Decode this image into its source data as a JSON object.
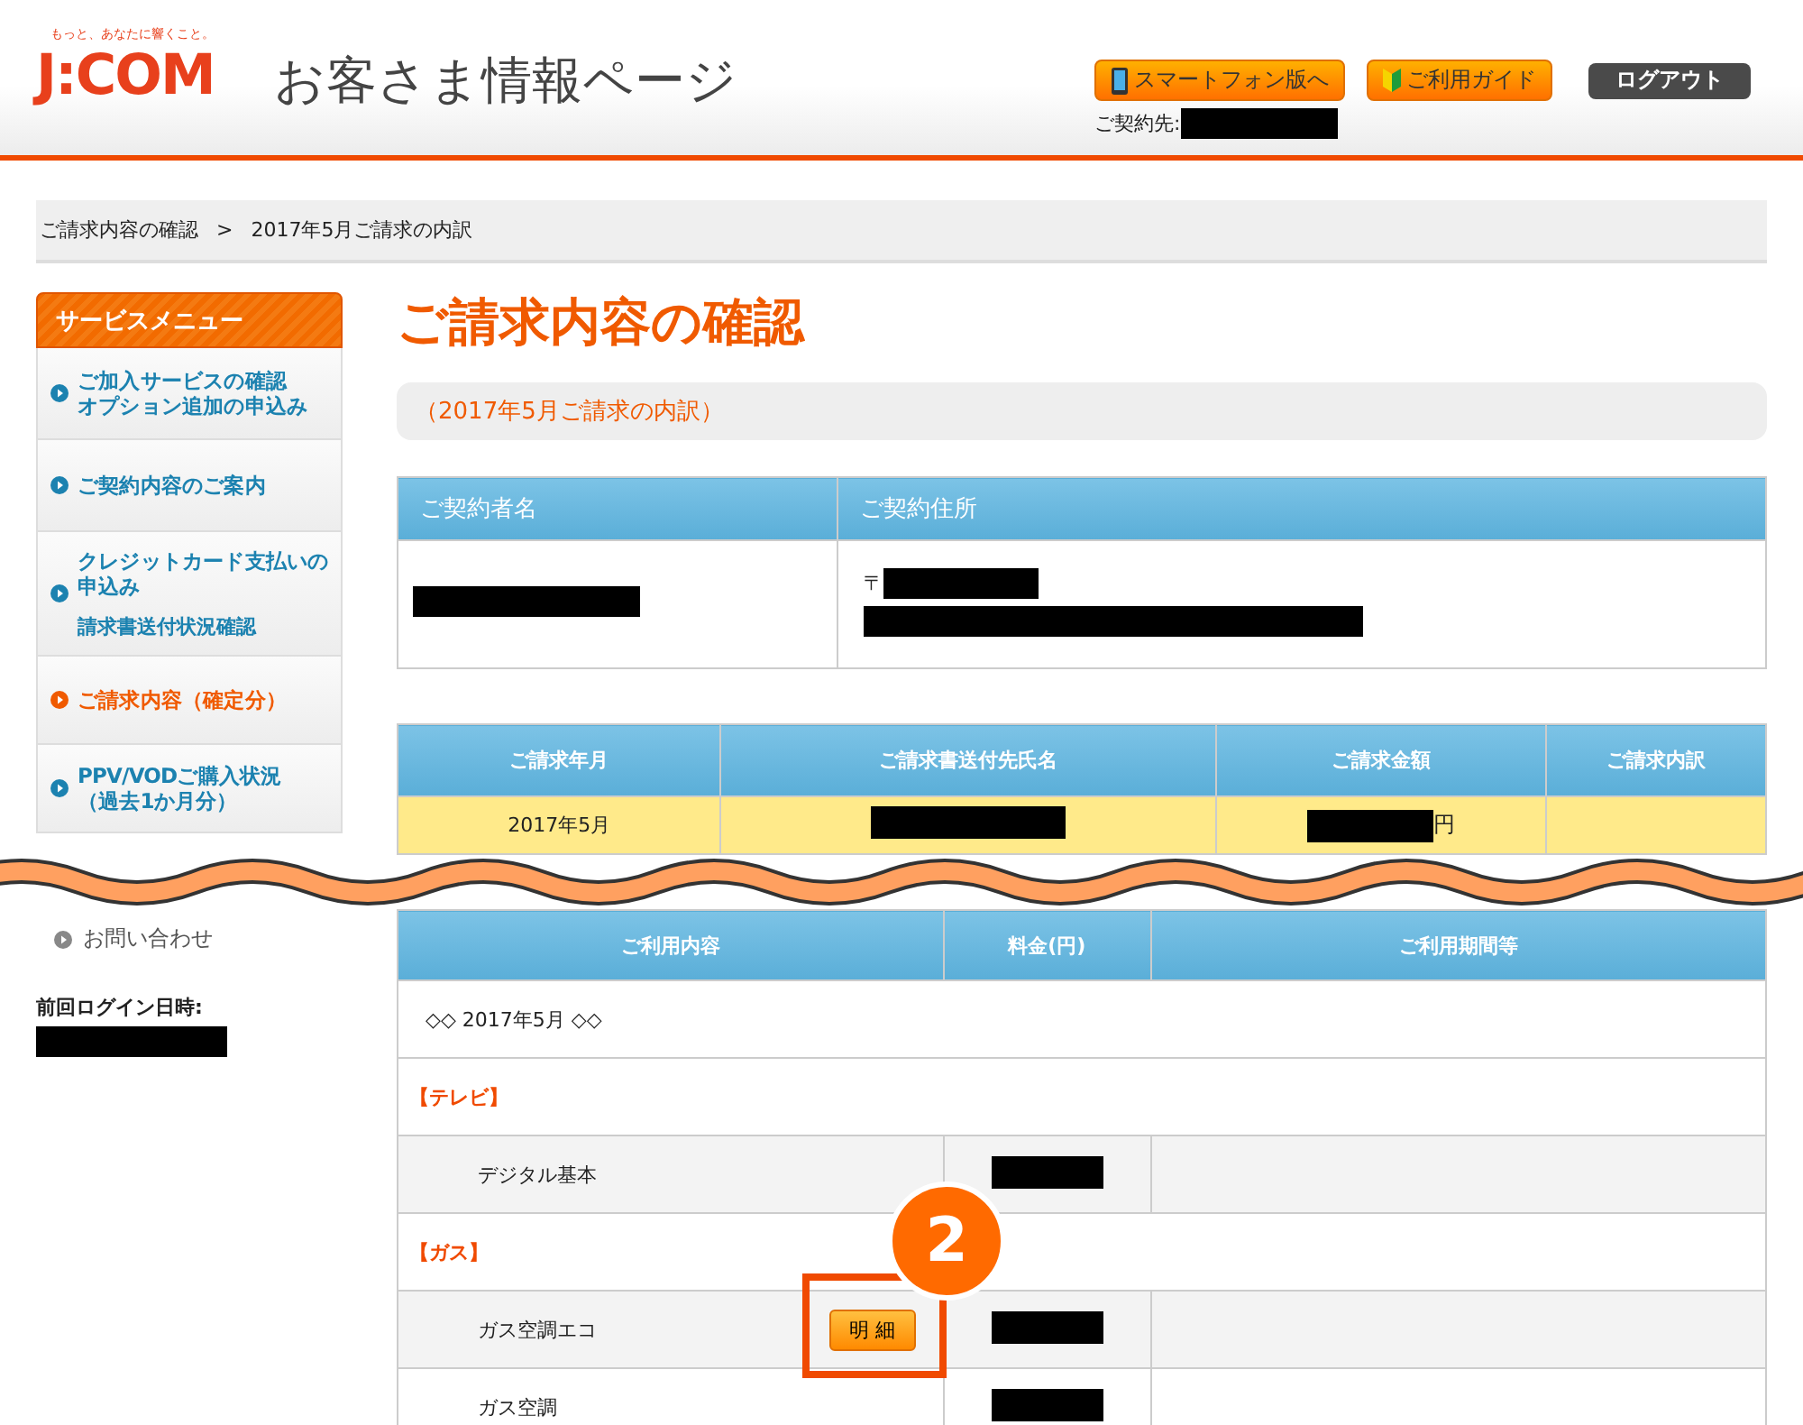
{
  "header": {
    "tagline": "もっと、あなたに響くこと。",
    "logo": "J:COM",
    "title": "お客さま情報ページ",
    "buttons": [
      {
        "label": "スマートフォン版へ",
        "kind": "phone"
      },
      {
        "label": "ご利用ガイド",
        "kind": "guide"
      },
      {
        "label": "ログアウト",
        "kind": "logout"
      }
    ],
    "contract_label": "ご契約先:"
  },
  "breadcrumb": {
    "items": [
      "ご請求内容の確認",
      "2017年5月ご請求の内訳"
    ],
    "separator": ">"
  },
  "sidebar": {
    "title": "サービスメニュー",
    "items": [
      {
        "lines": [
          "ご加入サービスの確認",
          "オプション追加の申込み"
        ],
        "selected": false
      },
      {
        "lines": [
          "ご契約内容のご案内"
        ],
        "selected": false
      },
      {
        "lines": [
          "クレジットカード支払いの",
          "申込み"
        ],
        "sublink": "請求書送付状況確認",
        "selected": false
      },
      {
        "lines": [
          "ご請求内容（確定分）"
        ],
        "selected": true
      },
      {
        "lines": [
          "PPV/VODご購入状況",
          "（過去1か月分）"
        ],
        "selected": false
      }
    ],
    "contact": "お問い合わせ",
    "last_login_label": "前回ログイン日時:"
  },
  "main": {
    "title": "ご請求内容の確認",
    "subtitle": "（2017年5月ご請求の内訳）",
    "contract_table": {
      "columns": [
        "ご契約者名",
        "ご契約住所"
      ],
      "postal_mark": "〒"
    },
    "billing_table": {
      "columns": [
        "ご請求年月",
        "ご請求書送付先氏名",
        "ご請求金額",
        "ご請求内訳"
      ],
      "month": "2017年5月",
      "currency": "円"
    },
    "detail_table": {
      "columns": [
        "ご利用内容",
        "料金(円)",
        "ご利用期間等"
      ],
      "rows": [
        {
          "kind": "period",
          "text": "◇◇ 2017年5月 ◇◇"
        },
        {
          "kind": "category",
          "text": "【テレビ】"
        },
        {
          "kind": "item",
          "text": "デジタル基本",
          "shaded": true
        },
        {
          "kind": "category",
          "text": "【ガス】"
        },
        {
          "kind": "item",
          "text": "ガス空調エコ",
          "shaded": true,
          "button": "明 細"
        },
        {
          "kind": "item",
          "text": "ガス空調",
          "shaded": false
        }
      ]
    },
    "annotation": {
      "number": "2"
    }
  }
}
